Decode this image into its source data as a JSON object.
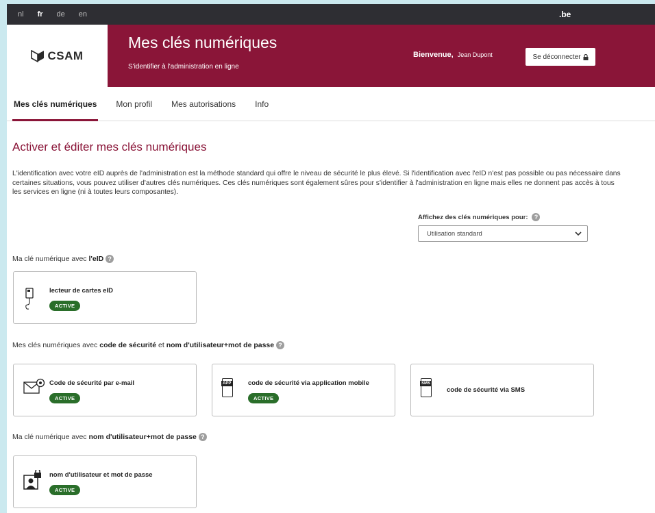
{
  "topbar": {
    "languages": [
      {
        "code": "nl",
        "selected": false
      },
      {
        "code": "fr",
        "selected": true
      },
      {
        "code": "de",
        "selected": false
      },
      {
        "code": "en",
        "selected": false
      }
    ],
    "domain": ".be"
  },
  "header": {
    "logo_text": "CSAM",
    "title": "Mes clés numériques",
    "subtitle": "S'identifier à l'administration en ligne",
    "welcome": "Bienvenue,",
    "user_name": "Jean Dupont",
    "logout_label": "Se déconnecter"
  },
  "nav": {
    "tabs": [
      {
        "label": "Mes clés numériques",
        "active": true
      },
      {
        "label": "Mon profil",
        "active": false
      },
      {
        "label": "Mes autorisations",
        "active": false
      },
      {
        "label": "Info",
        "active": false
      }
    ]
  },
  "main": {
    "heading": "Activer et éditer mes clés numériques",
    "intro": "L'identification avec votre eID auprès de l'administration est la méthode standard qui offre le niveau de sécurité le plus élevé. Si l'identification avec l'eID n'est pas possible ou pas nécessaire dans certaines situations, vous pouvez utiliser d'autres clés numériques. Ces clés numériques sont également sûres pour s'identifier à l'administration en ligne mais elles ne donnent pas accès à tous les services en ligne (ni à toutes leurs composantes).",
    "filter": {
      "label": "Affichez des clés numériques pour:",
      "selected": "Utilisation standard"
    },
    "sections": [
      {
        "prefix": "Ma clé numérique avec ",
        "bold1": "l'eID",
        "cards": [
          {
            "name": "lecteur de cartes eID",
            "status": "ACTIVE",
            "icon": "card-reader-icon"
          }
        ]
      },
      {
        "prefix": "Mes clés numériques avec ",
        "bold1": "code de sécurité",
        "middle": " et ",
        "bold2": "nom d'utilisateur+mot de passe",
        "cards": [
          {
            "name": "Code de sécurité par e-mail",
            "status": "ACTIVE",
            "icon": "email-icon"
          },
          {
            "name": "code de sécurité via application mobile",
            "status": "ACTIVE",
            "icon": "mobile-app-icon",
            "icon_text": "APP"
          },
          {
            "name": "code de sécurité via SMS",
            "status": "",
            "icon": "sms-icon",
            "icon_text": "SMS"
          }
        ]
      },
      {
        "prefix": "Ma clé numérique avec ",
        "bold1": "nom d'utilisateur+mot de passe",
        "cards": [
          {
            "name": "nom d'utilisateur et mot de passe",
            "status": "ACTIVE",
            "icon": "user-lock-icon"
          }
        ]
      }
    ]
  },
  "colors": {
    "brand": "#8a1538",
    "topbar": "#2e2e33",
    "badge": "#2a6e2a",
    "outer_bg": "#cbe9ef"
  }
}
